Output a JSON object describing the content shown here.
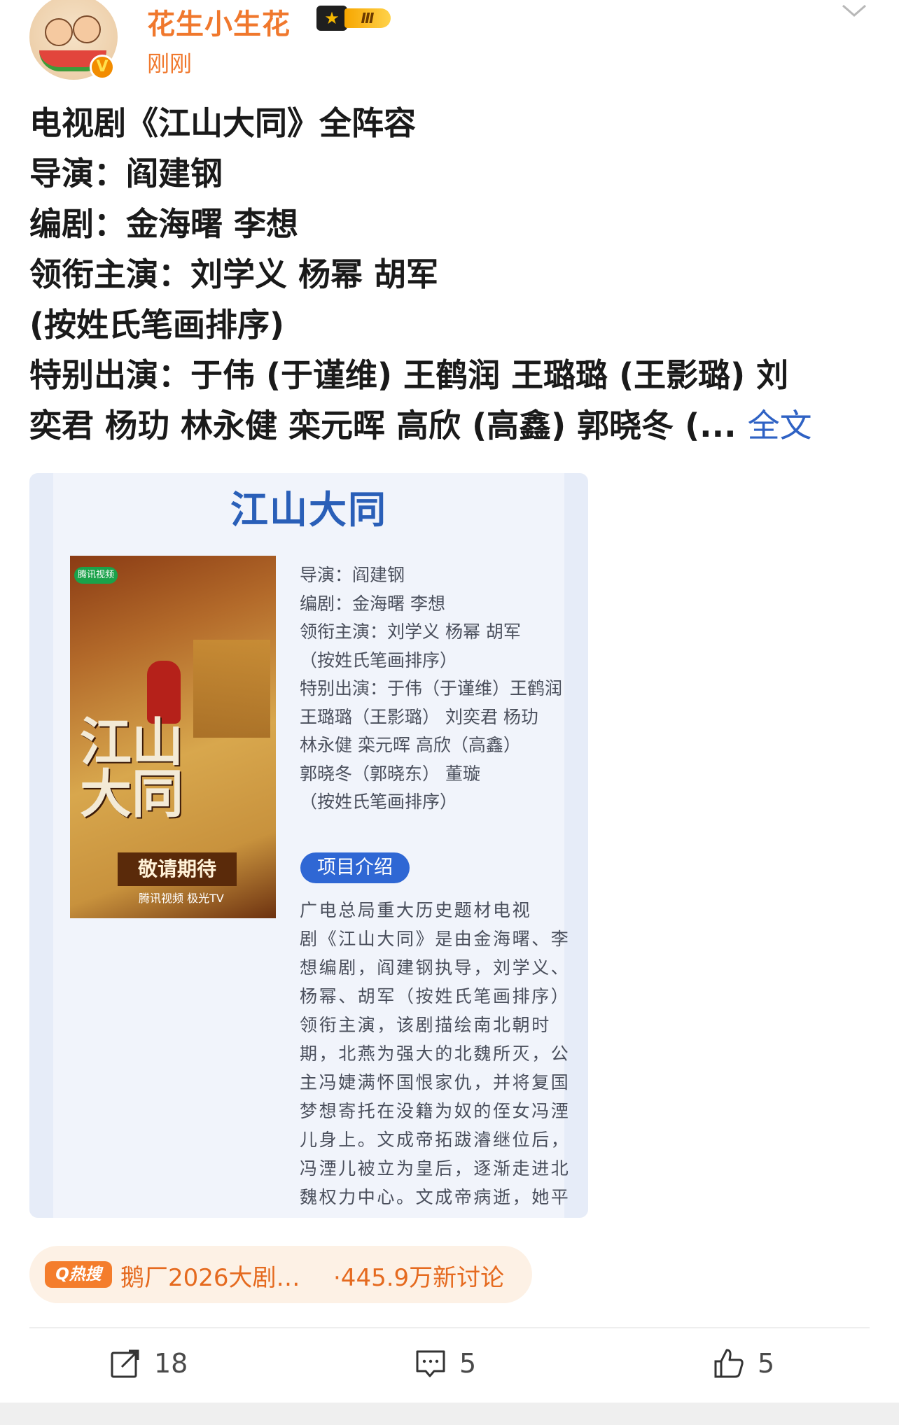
{
  "user": {
    "name": "花生小生花",
    "level_mark": "Ⅲ",
    "time": "刚刚"
  },
  "post": {
    "lines": [
      "电视剧《江山大同》全阵容",
      "导演：阎建钢",
      "编剧：金海曙 李想",
      "领衔主演：刘学义 杨幂 胡军",
      "(按姓氏笔画排序)",
      "特别出演：于伟 (于谨维) 王鹤润 王璐璐 (王影璐) 刘",
      "奕君 杨玏 林永健 栾元晖 高欣 (高鑫) 郭晓冬 (..."
    ],
    "full_link": "全文"
  },
  "card": {
    "title": "江山大同",
    "poster": {
      "tag": "腾讯视频",
      "calligraphy": "江山大同",
      "slogan": "敬请期待",
      "studio": "腾讯视频 极光TV"
    },
    "info_lines": [
      "导演：阎建钢",
      "编剧：金海曙 李想",
      "领衔主演：刘学义 杨幂 胡军",
      "（按姓氏笔画排序）",
      "特别出演：于伟（于谨维）王鹤润",
      "王璐璐（王影璐） 刘奕君 杨玏",
      "林永健 栾元晖 高欣（高鑫）",
      "郭晓冬（郭晓东） 董璇",
      "（按姓氏笔画排序）"
    ],
    "section_button": "项目介绍",
    "desc_lines": [
      "广电总局重大历史题材电视",
      "剧《江山大同》是由金海曙、李",
      "想编剧，阎建钢执导，刘学义、",
      "杨幂、胡军（按姓氏笔画排序）",
      "领衔主演，该剧描绘南北朝时",
      "期，北燕为强大的北魏所灭，公",
      "主冯婕满怀国恨家仇，并将复国",
      "梦想寄托在没籍为奴的侄女冯湮",
      "儿身上。文成帝拓跋濬继位后，",
      "冯湮儿被立为皇后，逐渐走进北",
      "魏权力中心。文成帝病逝，她平"
    ]
  },
  "hot_search": {
    "badge": "Q热搜",
    "topic": "鹅厂2026大剧…",
    "count": "·445.9万新讨论"
  },
  "actions": {
    "repost": "18",
    "comment": "5",
    "like": "5"
  },
  "colors": {
    "accent_orange": "#f0782d",
    "link_blue": "#2f62c4",
    "card_title_blue": "#2a5fb8",
    "pill_blue": "#2f67d4"
  }
}
